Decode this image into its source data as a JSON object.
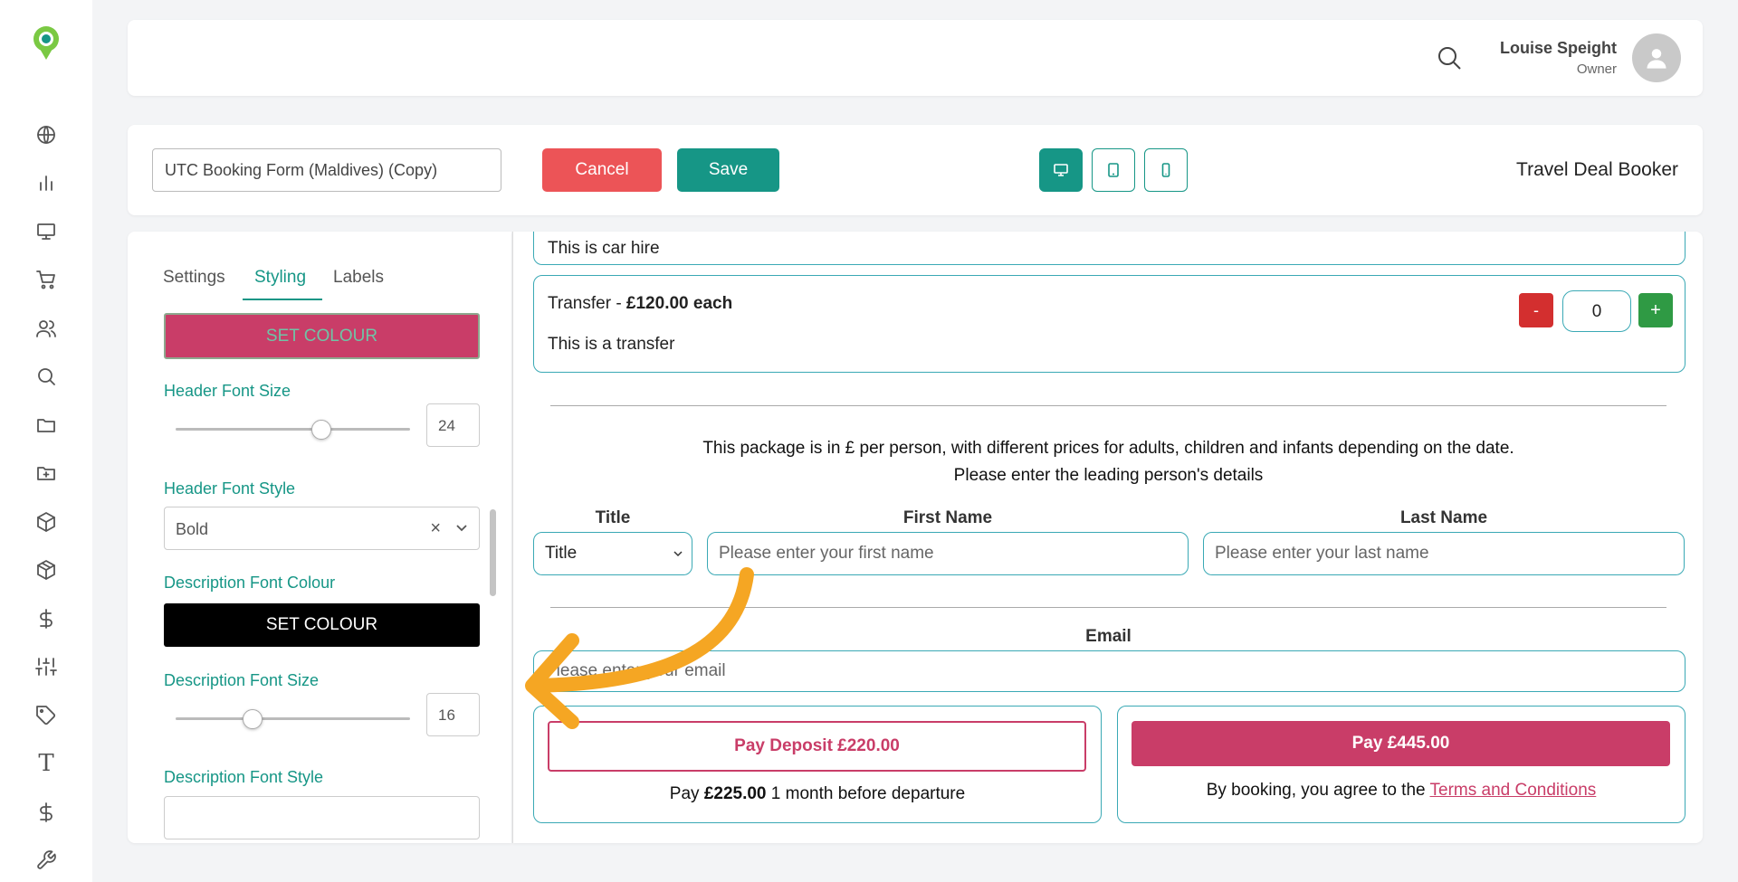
{
  "header": {
    "user_name": "Louise Speight",
    "user_role": "Owner"
  },
  "sidebar": {
    "items": [
      "globe-icon",
      "bar-chart-icon",
      "monitor-icon",
      "cart-icon",
      "users-icon",
      "search-icon",
      "folder-icon",
      "folder-plus-icon",
      "box-icon",
      "package-icon",
      "dollar-icon",
      "sliders-icon",
      "tag-icon",
      "text-icon",
      "dollar-icon",
      "wrench-icon"
    ]
  },
  "toolbar": {
    "form_name": "UTC Booking Form (Maldives) (Copy)",
    "cancel_label": "Cancel",
    "save_label": "Save",
    "app_name": "Travel Deal Booker",
    "active_device": "desktop"
  },
  "panel": {
    "tabs": [
      {
        "label": "Settings",
        "active": false
      },
      {
        "label": "Styling",
        "active": true
      },
      {
        "label": "Labels",
        "active": false
      }
    ],
    "set_colour_1": "SET COLOUR",
    "header_font_size_label": "Header Font Size",
    "header_font_size_value": "24",
    "header_font_size_fraction": 0.62,
    "header_font_style_label": "Header Font Style",
    "header_font_style_value": "Bold",
    "description_font_colour_label": "Description Font Colour",
    "set_colour_2": "SET COLOUR",
    "description_font_size_label": "Description Font Size",
    "description_font_size_value": "16",
    "description_font_size_fraction": 0.33,
    "description_font_style_label": "Description Font Style"
  },
  "preview": {
    "car_hire_desc": "This is car hire",
    "transfer": {
      "name": "Transfer - ",
      "price": "£120.00 each",
      "desc": "This is a transfer",
      "minus": "-",
      "qty": "0",
      "plus": "+"
    },
    "info_line_1": "This package is in £ per person, with different prices for adults, children and infants depending on the date.",
    "info_line_2": "Please enter the leading person's details",
    "title_label": "Title",
    "title_value": "Title",
    "first_name_label": "First Name",
    "first_name_placeholder": "Please enter your first name",
    "last_name_label": "Last Name",
    "last_name_placeholder": "Please enter your last name",
    "email_label": "Email",
    "email_placeholder": "Please enter your email",
    "deposit_button": "Pay Deposit £220.00",
    "deposit_note_pre": "Pay ",
    "deposit_note_amount": "£225.00",
    "deposit_note_post": " 1 month before departure",
    "pay_button": "Pay £445.00",
    "terms_pre": "By booking, you agree to the ",
    "terms_link": "Terms and Conditions"
  },
  "colors": {
    "teal": "#169686",
    "pink": "#c93d68",
    "red": "#ec5457",
    "annotation": "#f5a623"
  }
}
